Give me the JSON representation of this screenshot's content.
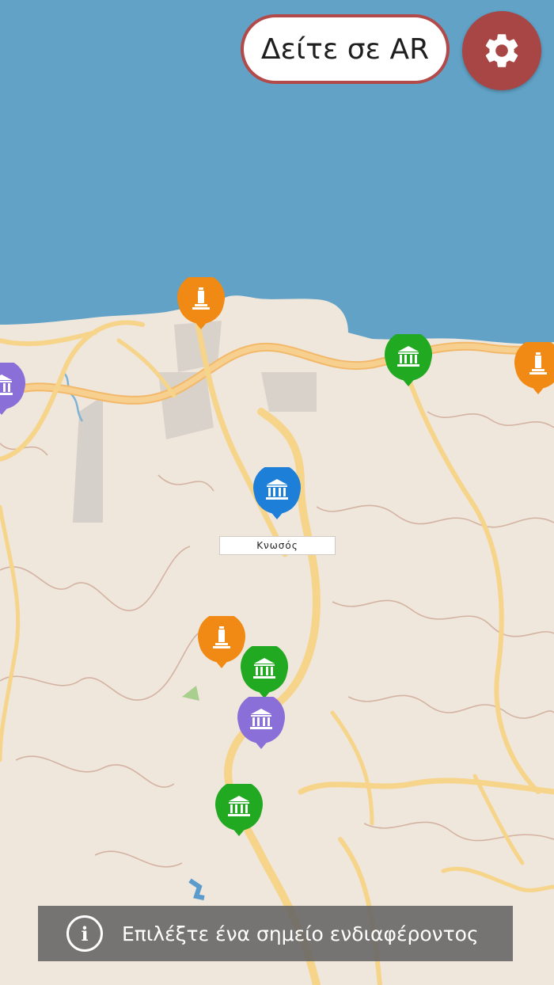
{
  "header": {
    "ar_button_label": "Δείτε σε AR",
    "settings_icon": "gear-icon"
  },
  "map": {
    "place_label": "Κνωσός",
    "sea_color": "#61a2c6",
    "land_color": "#efe6dc",
    "road_color": "#f6d48a",
    "markers": [
      {
        "type": "monument",
        "color": "#f08a14",
        "icon": "monument-icon"
      },
      {
        "type": "museum",
        "color": "#22a922",
        "icon": "museum-icon"
      },
      {
        "type": "monument",
        "color": "#f08a14",
        "icon": "monument-icon"
      },
      {
        "type": "museum",
        "color": "#8b6fd9",
        "icon": "museum-icon"
      },
      {
        "type": "museum",
        "color": "#1e7fd9",
        "icon": "museum-icon"
      },
      {
        "type": "monument",
        "color": "#f08a14",
        "icon": "monument-icon"
      },
      {
        "type": "museum",
        "color": "#22a922",
        "icon": "museum-icon"
      },
      {
        "type": "museum",
        "color": "#8b6fd9",
        "icon": "museum-icon"
      },
      {
        "type": "museum",
        "color": "#22a922",
        "icon": "museum-icon"
      }
    ]
  },
  "banner": {
    "icon": "info-icon",
    "text": "Επιλέξτε ένα σημείο ενδιαφέροντος"
  }
}
